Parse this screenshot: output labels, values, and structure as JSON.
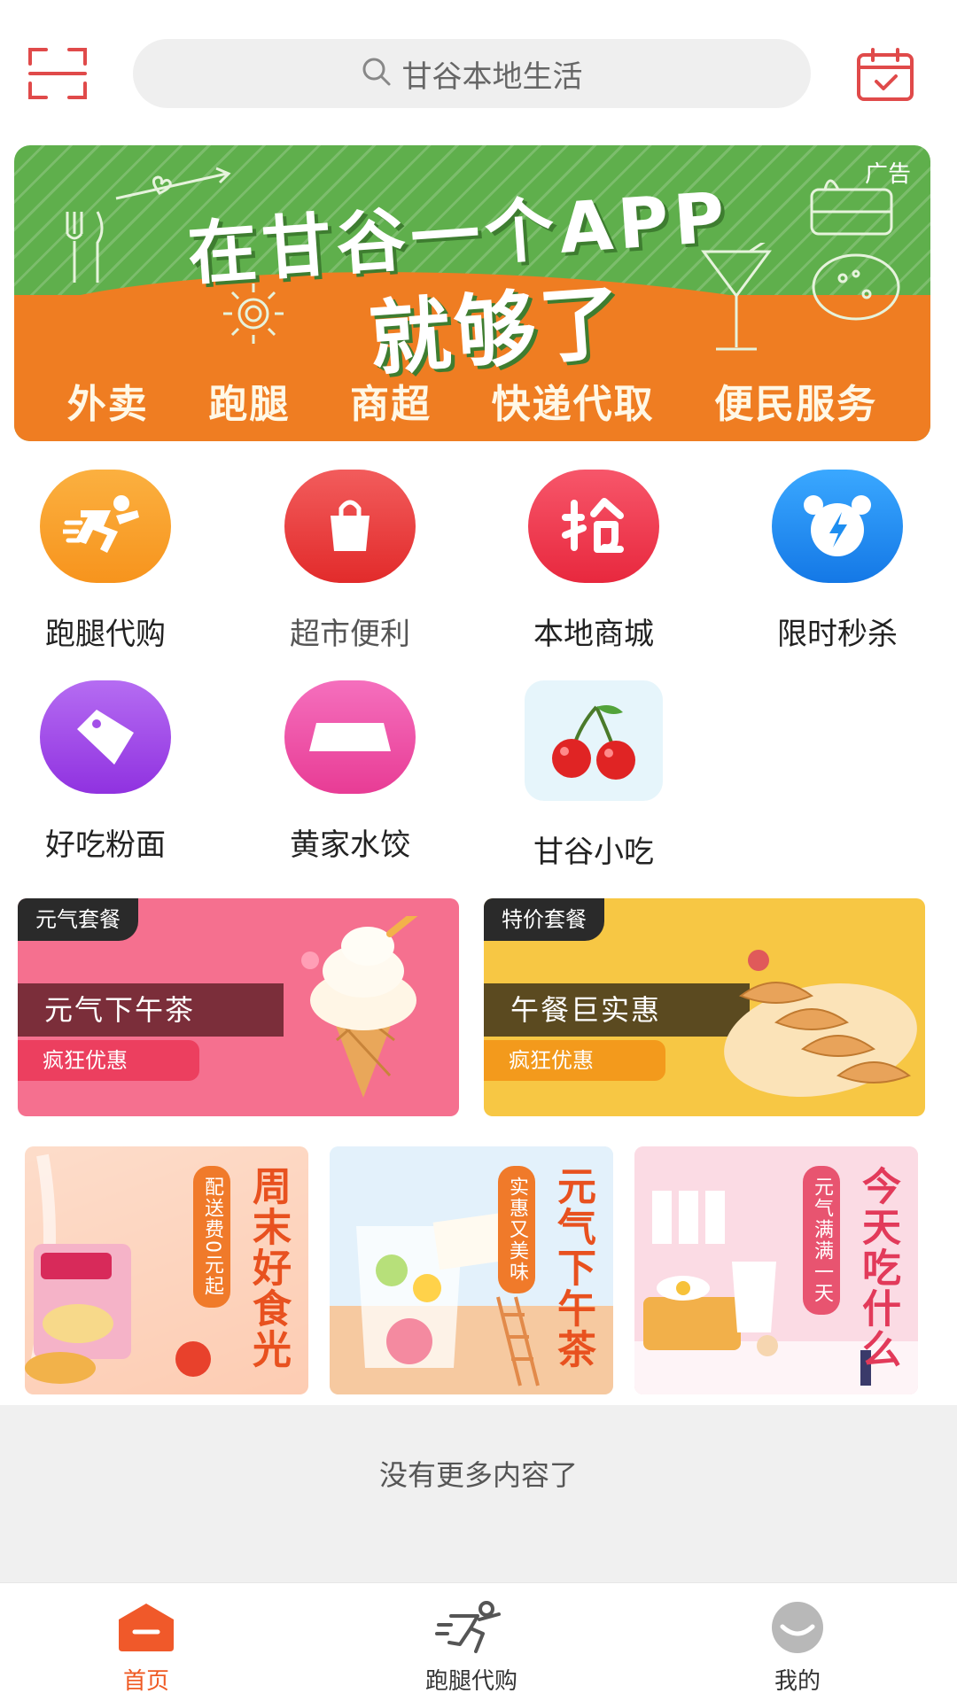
{
  "header": {
    "search_placeholder": "甘谷本地生活",
    "scan_icon": "scan-icon",
    "calendar_icon": "calendar-check-icon"
  },
  "banner": {
    "ad_label": "广告",
    "headline_line1": "在甘谷一个APP",
    "headline_line2": "就够了",
    "services": [
      "外卖",
      "跑腿",
      "商超",
      "快递代取",
      "便民服务"
    ]
  },
  "categories": [
    {
      "label": "跑腿代购",
      "icon": "running-man-icon",
      "color": "#f7941d"
    },
    {
      "label": "超市便利",
      "icon": "shopping-bag-icon",
      "color": "#ee3b3b"
    },
    {
      "label": "本地商城",
      "icon": "grab-char-icon",
      "color": "#f03a4e"
    },
    {
      "label": "限时秒杀",
      "icon": "alarm-clock-icon",
      "color": "#1e8ef0"
    },
    {
      "label": "好吃粉面",
      "icon": "tag-icon",
      "color": "#a34fe8"
    },
    {
      "label": "黄家水饺",
      "icon": "dumpling-icon",
      "color": "#f04fa8"
    },
    {
      "label": "甘谷小吃",
      "icon": "cherry-icon",
      "color": "#e8f4fb"
    }
  ],
  "promos": [
    {
      "tag": "元气套餐",
      "title": "元气下午茶",
      "subtitle": "疯狂优惠",
      "bg": "#f56f8e"
    },
    {
      "tag": "特价套餐",
      "title": "午餐巨实惠",
      "subtitle": "疯狂优惠",
      "bg": "#f7c744"
    }
  ],
  "features": [
    {
      "title": "周末好食光",
      "badge": "配送费0元起"
    },
    {
      "title": "元气下午茶",
      "badge": "实惠又美味"
    },
    {
      "title": "今天吃什么",
      "badge": "元气满满一天"
    }
  ],
  "footer_note": "没有更多内容了",
  "bottom_nav": [
    {
      "label": "首页",
      "icon": "home-icon",
      "active": true
    },
    {
      "label": "跑腿代购",
      "icon": "runner-icon",
      "active": false
    },
    {
      "label": "我的",
      "icon": "profile-icon",
      "active": false
    }
  ]
}
